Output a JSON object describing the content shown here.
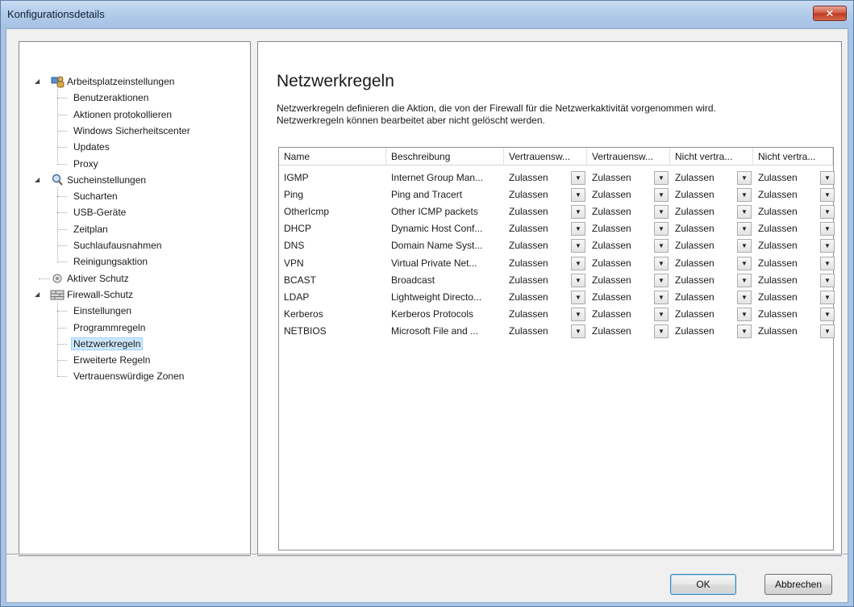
{
  "window": {
    "title": "Konfigurationsdetails",
    "close_glyph": "✕"
  },
  "tree": {
    "groups": [
      {
        "label": "Arbeitsplatzeinstellungen",
        "icon": "workstation-icon",
        "children": [
          "Benutzeraktionen",
          "Aktionen protokollieren",
          "Windows Sicherheitscenter",
          "Updates",
          "Proxy"
        ]
      },
      {
        "label": "Sucheinstellungen",
        "icon": "search-settings-icon",
        "children": [
          "Sucharten",
          "USB-Geräte",
          "Zeitplan",
          "Suchlaufausnahmen",
          "Reinigungsaktion"
        ]
      },
      {
        "label": "Aktiver Schutz",
        "icon": "active-protection-icon",
        "children": []
      },
      {
        "label": "Firewall-Schutz",
        "icon": "firewall-icon",
        "children": [
          "Einstellungen",
          "Programmregeln",
          "Netzwerkregeln",
          "Erweiterte Regeln",
          "Vertrauenswürdige Zonen"
        ]
      }
    ],
    "selected": "Netzwerkregeln"
  },
  "main": {
    "title": "Netzwerkregeln",
    "description_line1": "Netzwerkregeln definieren die Aktion, die von der Firewall für die Netzwerkaktivität vorgenommen wird.",
    "description_line2": "Netzwerkregeln können bearbeitet aber nicht gelöscht werden."
  },
  "table": {
    "columns": [
      "Name",
      "Beschreibung",
      "Vertrauensw...",
      "Vertrauensw...",
      "Nicht vertra...",
      "Nicht vertra..."
    ],
    "rows": [
      {
        "name": "IGMP",
        "description": "Internet Group Man...",
        "actions": [
          "Zulassen",
          "Zulassen",
          "Zulassen",
          "Zulassen"
        ]
      },
      {
        "name": "Ping",
        "description": "Ping and Tracert",
        "actions": [
          "Zulassen",
          "Zulassen",
          "Zulassen",
          "Zulassen"
        ]
      },
      {
        "name": "OtherIcmp",
        "description": "Other ICMP packets",
        "actions": [
          "Zulassen",
          "Zulassen",
          "Zulassen",
          "Zulassen"
        ]
      },
      {
        "name": "DHCP",
        "description": "Dynamic Host Conf...",
        "actions": [
          "Zulassen",
          "Zulassen",
          "Zulassen",
          "Zulassen"
        ]
      },
      {
        "name": "DNS",
        "description": "Domain Name Syst...",
        "actions": [
          "Zulassen",
          "Zulassen",
          "Zulassen",
          "Zulassen"
        ]
      },
      {
        "name": "VPN",
        "description": "Virtual Private Net...",
        "actions": [
          "Zulassen",
          "Zulassen",
          "Zulassen",
          "Zulassen"
        ]
      },
      {
        "name": "BCAST",
        "description": "Broadcast",
        "actions": [
          "Zulassen",
          "Zulassen",
          "Zulassen",
          "Zulassen"
        ]
      },
      {
        "name": "LDAP",
        "description": "Lightweight Directo...",
        "actions": [
          "Zulassen",
          "Zulassen",
          "Zulassen",
          "Zulassen"
        ]
      },
      {
        "name": "Kerberos",
        "description": "Kerberos Protocols",
        "actions": [
          "Zulassen",
          "Zulassen",
          "Zulassen",
          "Zulassen"
        ]
      },
      {
        "name": "NETBIOS",
        "description": "Microsoft File and ...",
        "actions": [
          "Zulassen",
          "Zulassen",
          "Zulassen",
          "Zulassen"
        ]
      }
    ]
  },
  "buttons": {
    "ok": "OK",
    "cancel": "Abbrechen"
  }
}
